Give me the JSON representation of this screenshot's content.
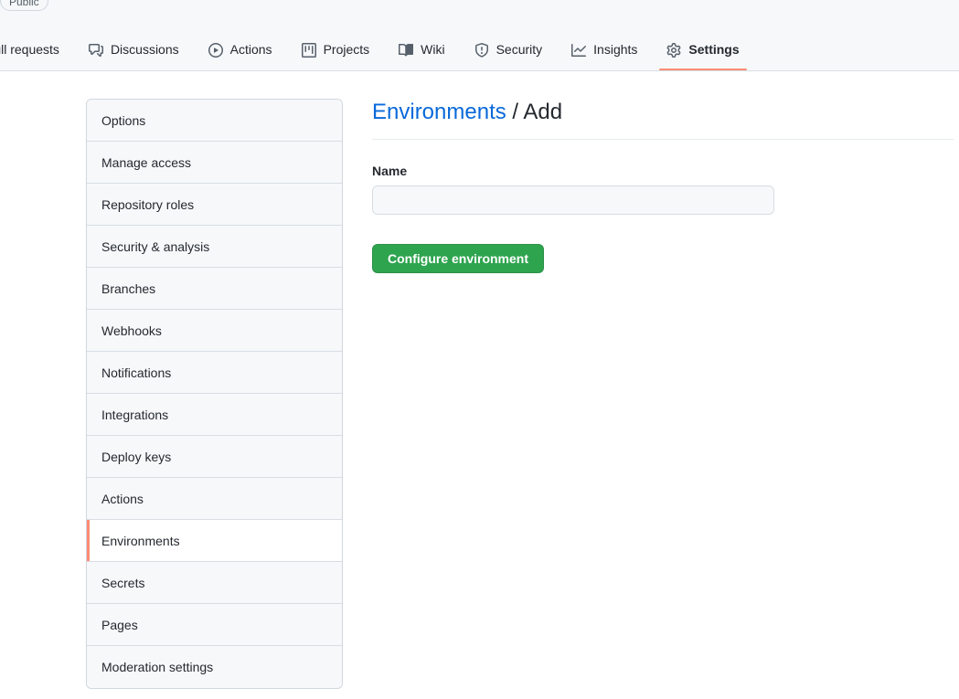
{
  "repo_header": {
    "visibility_badge": "Public"
  },
  "nav": {
    "items": [
      {
        "label": "Pull requests",
        "icon": "git-pull-request-icon",
        "selected": false,
        "clipped": true
      },
      {
        "label": "Discussions",
        "icon": "comment-discussion-icon",
        "selected": false,
        "clipped": false
      },
      {
        "label": "Actions",
        "icon": "play-circle-icon",
        "selected": false,
        "clipped": false
      },
      {
        "label": "Projects",
        "icon": "project-board-icon",
        "selected": false,
        "clipped": false
      },
      {
        "label": "Wiki",
        "icon": "book-icon",
        "selected": false,
        "clipped": false
      },
      {
        "label": "Security",
        "icon": "shield-alert-icon",
        "selected": false,
        "clipped": false
      },
      {
        "label": "Insights",
        "icon": "graph-icon",
        "selected": false,
        "clipped": false
      },
      {
        "label": "Settings",
        "icon": "gear-icon",
        "selected": true,
        "clipped": false
      }
    ]
  },
  "sidebar": {
    "items": [
      {
        "label": "Options",
        "selected": false
      },
      {
        "label": "Manage access",
        "selected": false
      },
      {
        "label": "Repository roles",
        "selected": false
      },
      {
        "label": "Security & analysis",
        "selected": false
      },
      {
        "label": "Branches",
        "selected": false
      },
      {
        "label": "Webhooks",
        "selected": false
      },
      {
        "label": "Notifications",
        "selected": false
      },
      {
        "label": "Integrations",
        "selected": false
      },
      {
        "label": "Deploy keys",
        "selected": false
      },
      {
        "label": "Actions",
        "selected": false
      },
      {
        "label": "Environments",
        "selected": true
      },
      {
        "label": "Secrets",
        "selected": false
      },
      {
        "label": "Pages",
        "selected": false
      },
      {
        "label": "Moderation settings",
        "selected": false
      }
    ]
  },
  "main": {
    "heading": {
      "link_text": "Environments",
      "separator": "/",
      "current": "Add"
    },
    "form": {
      "name_label": "Name",
      "name_value": "",
      "name_placeholder": "",
      "submit_label": "Configure environment"
    }
  },
  "colors": {
    "accent_underline": "#fd8c73",
    "link": "#0969da",
    "button_green": "#2ea44f",
    "header_bg": "#f6f8fa",
    "border": "#d0d7de"
  }
}
